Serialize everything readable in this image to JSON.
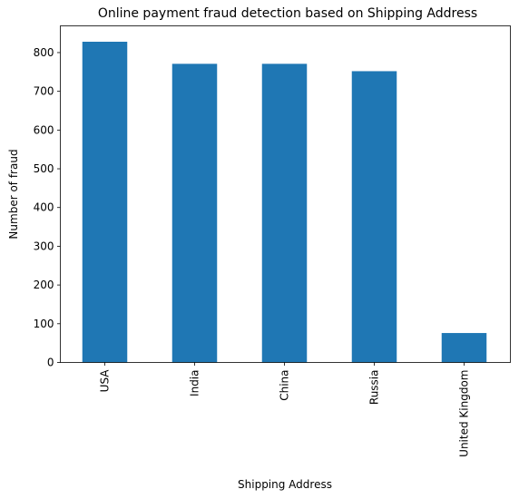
{
  "chart_data": {
    "type": "bar",
    "title": "Online payment fraud detection based on Shipping Address",
    "xlabel": "Shipping Address",
    "ylabel": "Number of fraud",
    "categories": [
      "USA",
      "India",
      "China",
      "Russia",
      "United Kingdom"
    ],
    "values": [
      828,
      771,
      771,
      752,
      76
    ],
    "ylim": [
      0,
      869
    ],
    "yticks": [
      0,
      100,
      200,
      300,
      400,
      500,
      600,
      700,
      800
    ],
    "grid": false,
    "legend": "none",
    "bar_color": "#1f77b4"
  }
}
